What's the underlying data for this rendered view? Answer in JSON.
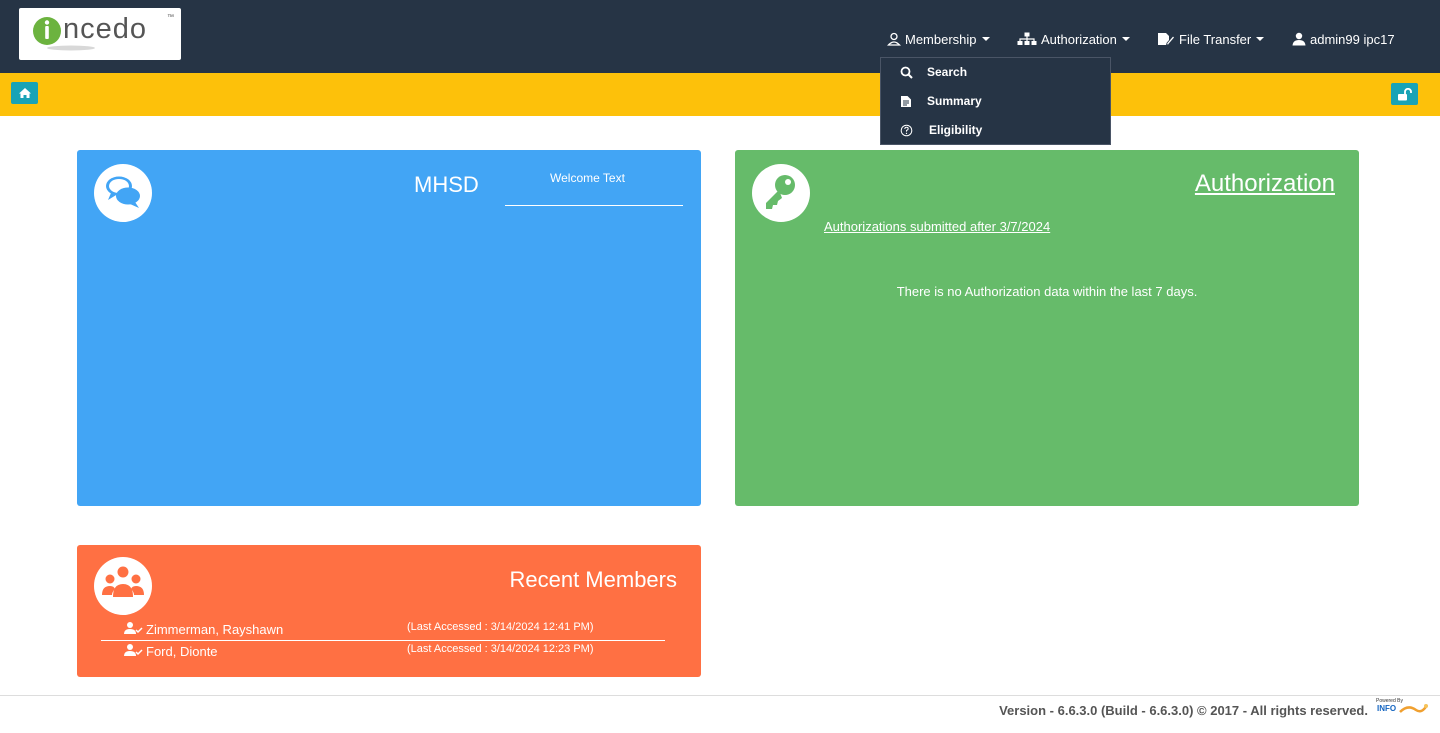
{
  "app": {
    "logo_text": "ncedo",
    "trademark": "™"
  },
  "nav": {
    "membership": "Membership",
    "authorization": "Authorization",
    "file_transfer": "File Transfer",
    "user": "admin99 ipc17"
  },
  "dropdown": {
    "items": [
      {
        "label": "Search",
        "icon": "search-icon"
      },
      {
        "label": "Summary",
        "icon": "document-icon"
      },
      {
        "label": "Eligibility",
        "icon": "question-circle-icon"
      }
    ]
  },
  "welcome_card": {
    "title": "MHSD",
    "subtitle": "Welcome Text"
  },
  "auth_card": {
    "title": "Authorization",
    "link": "Authorizations submitted after 3/7/2024",
    "message": "There is no Authorization data within the last 7 days."
  },
  "members_card": {
    "title": "Recent Members",
    "members": [
      {
        "name": "Zimmerman, Rayshawn",
        "accessed": "(Last Accessed : 3/14/2024 12:41 PM)"
      },
      {
        "name": "Ford, Dionte",
        "accessed": "(Last Accessed : 3/14/2024 12:23 PM)"
      }
    ]
  },
  "footer": {
    "version": "Version - 6.6.3.0 (Build - 6.6.3.0) © 2017 - All rights reserved.",
    "powered_by": "Powered By",
    "powered_brand": "INFO"
  },
  "colors": {
    "navbar": "#263445",
    "yellow_bar": "#fdc10a",
    "blue_card": "#42a5f5",
    "green_card": "#66bb6a",
    "orange_card": "#ff7043",
    "button_teal": "#19a3b6"
  }
}
